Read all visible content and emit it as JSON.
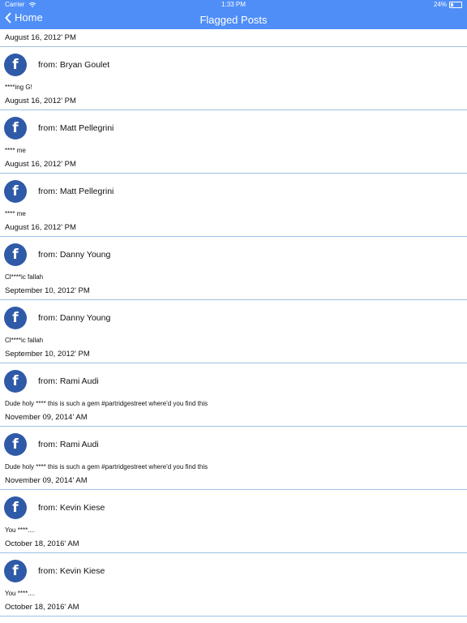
{
  "status": {
    "carrier": "Carrier",
    "time": "1:33 PM",
    "battery": "24%",
    "battery_level": 0.24
  },
  "nav": {
    "back_label": "Home",
    "title": "Flagged Posts"
  },
  "top_date": "August 16, 2012' PM",
  "posts": [
    {
      "from": "from: Bryan Goulet",
      "text": "****ing G!",
      "date": "August 16, 2012' PM"
    },
    {
      "from": "from: Matt Pellegrini",
      "text": "**** me",
      "date": "August 16, 2012' PM"
    },
    {
      "from": "from: Matt Pellegrini",
      "text": "**** me",
      "date": "August 16, 2012' PM"
    },
    {
      "from": "from: Danny Young",
      "text": "Cl****ic fallah",
      "date": "September 10, 2012' PM"
    },
    {
      "from": "from: Danny Young",
      "text": "Cl****ic fallah",
      "date": "September 10, 2012' PM"
    },
    {
      "from": "from: Rami Audi",
      "text": "Dude holy **** this is such  a gem #partridgestreet where'd you find this",
      "date": "November 09, 2014' AM"
    },
    {
      "from": "from: Rami Audi",
      "text": "Dude holy **** this is such  a gem #partridgestreet where'd you find this",
      "date": "November 09, 2014' AM"
    },
    {
      "from": "from: Kevin Kiese",
      "text": "You ****....",
      "date": "October 18, 2016' AM"
    },
    {
      "from": "from: Kevin Kiese",
      "text": "You ****....",
      "date": "October 18, 2016' AM"
    }
  ],
  "avatar_letter": "f",
  "colors": {
    "accent": "#4f8ef7",
    "facebook": "#2f5aa8",
    "divider": "#9ec1e6"
  }
}
